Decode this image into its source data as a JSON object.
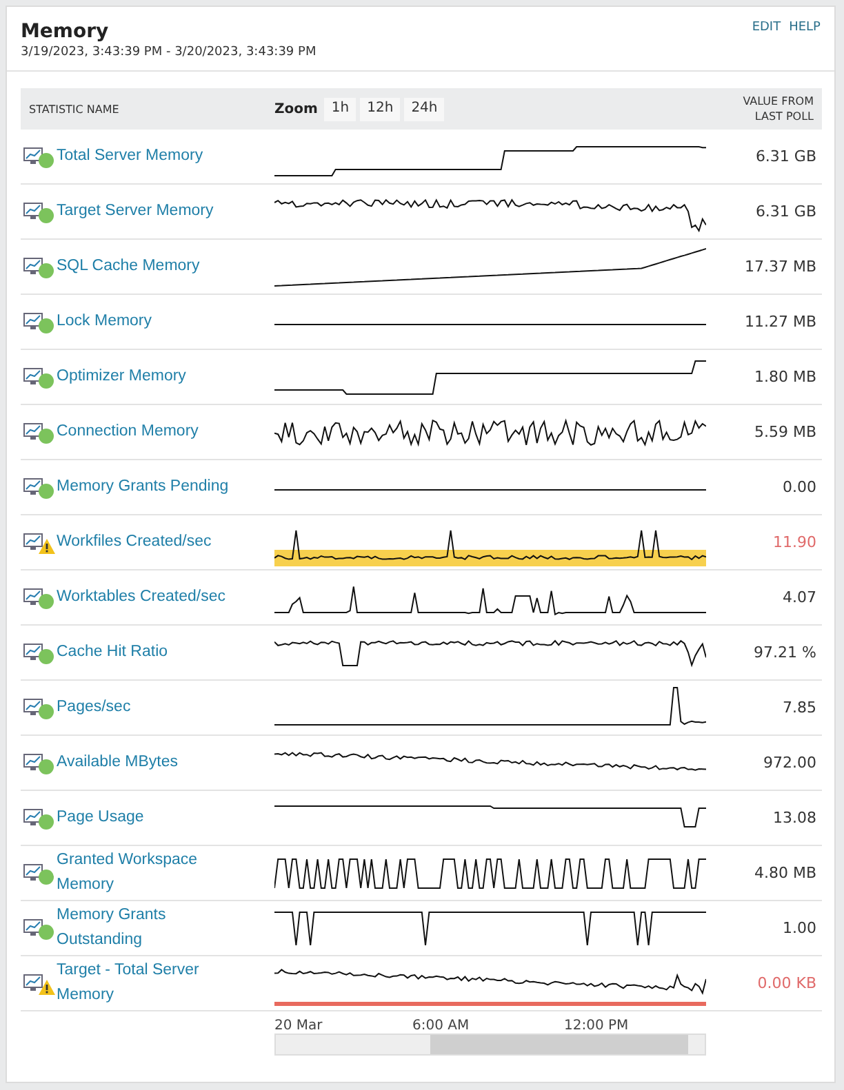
{
  "widget": {
    "title": "Memory",
    "range": "3/19/2023, 3:43:39 PM - 3/20/2023, 3:43:39 PM",
    "actions": [
      "EDIT",
      "HELP"
    ]
  },
  "table": {
    "columns": {
      "name": "STATISTIC NAME",
      "zoom": "Zoom",
      "value": "VALUE FROM LAST POLL"
    },
    "zoom_options": [
      "1h",
      "12h",
      "24h"
    ],
    "rows": [
      {
        "name": "Total Server Memory",
        "kind": "ok",
        "value": "6.31 GB"
      },
      {
        "name": "Target Server Memory",
        "kind": "ok",
        "value": "6.31 GB"
      },
      {
        "name": "SQL Cache Memory",
        "kind": "ok",
        "value": "17.37 MB"
      },
      {
        "name": "Lock Memory",
        "kind": "ok",
        "value": "11.27 MB"
      },
      {
        "name": "Optimizer Memory",
        "kind": "ok",
        "value": "1.80 MB"
      },
      {
        "name": "Connection Memory",
        "kind": "ok",
        "value": "5.59 MB"
      },
      {
        "name": "Memory Grants Pending",
        "kind": "ok",
        "value": "0.00"
      },
      {
        "name": "Workfiles Created/sec",
        "kind": "band",
        "value": "11.90"
      },
      {
        "name": "Worktables Created/sec",
        "kind": "ok",
        "value": "4.07"
      },
      {
        "name": "Cache Hit Ratio",
        "kind": "ok",
        "value": "97.21 %"
      },
      {
        "name": "Pages/sec",
        "kind": "ok",
        "value": "7.85"
      },
      {
        "name": "Available MBytes",
        "kind": "ok",
        "value": "972.00"
      },
      {
        "name": "Page Usage",
        "kind": "ok",
        "value": "13.08"
      },
      {
        "name": "Granted Workspace Memory",
        "kind": "ok",
        "value": "4.80 MB"
      },
      {
        "name": "Memory Grants Outstanding",
        "kind": "ok",
        "value": "1.00"
      },
      {
        "name": "Target - Total Server Memory",
        "kind": "line",
        "value": "0.00 KB"
      }
    ],
    "time_axis": [
      "20 Mar",
      "6:00 AM",
      "12:00 PM"
    ]
  }
}
